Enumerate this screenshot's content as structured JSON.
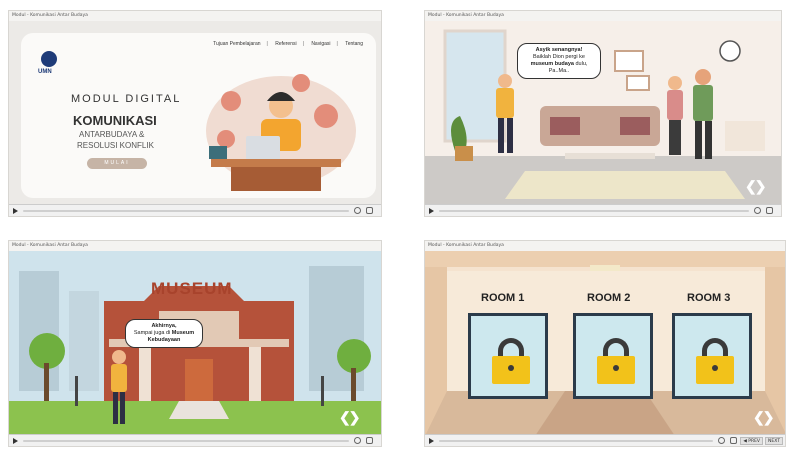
{
  "panels": {
    "p1": {
      "window_title": "Modul - Komunikasi Antar Budaya",
      "logo_text": "UMN",
      "nav": [
        "Tujuan Pembelajaran",
        "Referensi",
        "Navigasi",
        "Tentang"
      ],
      "title_line1": "MODUL DIGITAL",
      "title_line2": "KOMUNIKASI",
      "title_line3": "ANTARBUDAYA &",
      "title_line4": "RESOLUSI KONFLIK",
      "start_button": "MULAI"
    },
    "p2": {
      "window_title": "Modul - Komunikasi Antar Budaya",
      "bubble_line1": "Asyik senangnya!",
      "bubble_line2": "Baiklah Dion pergi ke",
      "bubble_bold": "museum budaya",
      "bubble_line3": " dulu,",
      "bubble_line4": "Pa..Ma..",
      "nav_arrows": "❮❯"
    },
    "p3": {
      "window_title": "Modul - Komunikasi Antar Budaya",
      "building_sign": "MUSEUM",
      "bubble_line1": "Akhirnya,",
      "bubble_line2": "Sampai juga di ",
      "bubble_bold1": "Museum",
      "bubble_bold2": "Kebudayaan",
      "nav_arrows": "❮❯"
    },
    "p4": {
      "window_title": "Modul - Komunikasi Antar Budaya",
      "rooms": [
        "ROOM 1",
        "ROOM 2",
        "ROOM 3"
      ],
      "nav_arrows": "❮❯",
      "prev_label": "◀ PREV",
      "next_label": "NEXT"
    }
  },
  "colors": {
    "accent_beige": "#c6b4a6",
    "lock_yellow": "#f2c21a",
    "museum_red": "#b5523a"
  }
}
